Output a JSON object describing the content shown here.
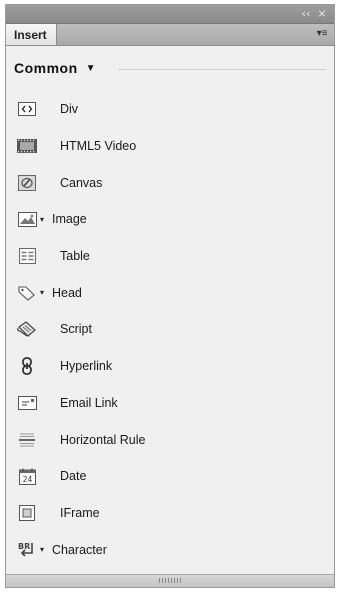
{
  "titlebar": {
    "collapse_glyph": "‹‹",
    "close_glyph": "×"
  },
  "tab": {
    "label": "Insert",
    "menu_glyph": "▾≡"
  },
  "category": {
    "label": "Common",
    "caret": "▼"
  },
  "items": [
    {
      "name": "div",
      "label": "Div",
      "icon": "div-icon",
      "dropdown": false
    },
    {
      "name": "html5-video",
      "label": "HTML5 Video",
      "icon": "film-icon",
      "dropdown": false
    },
    {
      "name": "canvas",
      "label": "Canvas",
      "icon": "canvas-icon",
      "dropdown": false
    },
    {
      "name": "image",
      "label": "Image",
      "icon": "image-icon",
      "dropdown": true
    },
    {
      "name": "table",
      "label": "Table",
      "icon": "table-icon",
      "dropdown": false
    },
    {
      "name": "head",
      "label": "Head",
      "icon": "tag-icon",
      "dropdown": true
    },
    {
      "name": "script",
      "label": "Script",
      "icon": "scroll-icon",
      "dropdown": false
    },
    {
      "name": "hyperlink",
      "label": "Hyperlink",
      "icon": "chain-link-icon",
      "dropdown": false
    },
    {
      "name": "email-link",
      "label": "Email Link",
      "icon": "envelope-icon",
      "dropdown": false
    },
    {
      "name": "horizontal-rule",
      "label": "Horizontal Rule",
      "icon": "horizontal-rule-icon",
      "dropdown": false
    },
    {
      "name": "date",
      "label": "Date",
      "icon": "calendar-icon",
      "dropdown": false
    },
    {
      "name": "iframe",
      "label": "IFrame",
      "icon": "iframe-icon",
      "dropdown": false
    },
    {
      "name": "character",
      "label": "Character",
      "icon": "line-break-icon",
      "dropdown": true
    }
  ],
  "calendar_day": "24",
  "line_break_text": "BR",
  "dropdown_caret": "▾"
}
